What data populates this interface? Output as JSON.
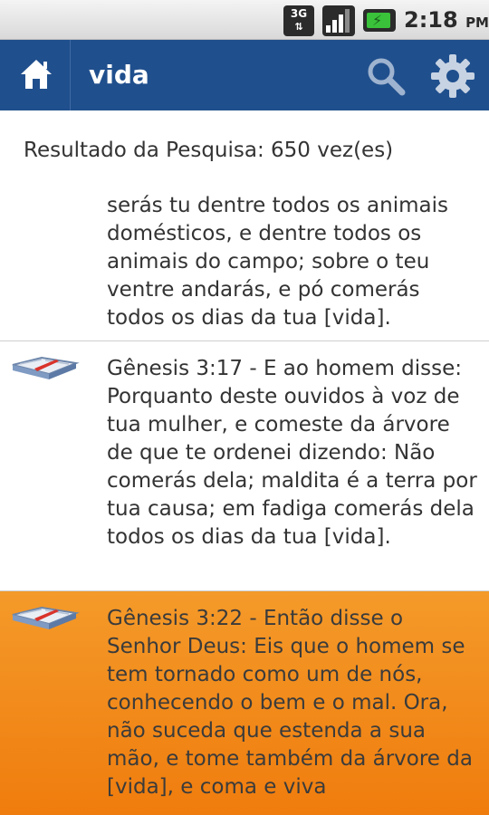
{
  "status_bar": {
    "network": "3G",
    "time": "2:18",
    "ampm": "PM"
  },
  "action_bar": {
    "title": "vida",
    "icons": [
      "home-icon",
      "search-icon",
      "gear-icon"
    ]
  },
  "results": {
    "summary": "Resultado da Pesquisa: 650 vez(es)",
    "items": [
      {
        "text": "serás tu dentre todos os animais domésticos, e dentre todos os animais do campo; sobre o teu ventre andarás, e pó comerás todos os dias da tua [vida].",
        "icon": "",
        "selected": false
      },
      {
        "text": "Gênesis 3:17 - E ao homem disse: Porquanto deste ouvidos à voz de tua mulher, e comeste da árvore de que te ordenei dizendo: Não comerás dela; maldita é a terra por tua causa; em fadiga comerás dela todos os dias da tua [vida].",
        "icon": "open-book-icon",
        "selected": false
      },
      {
        "text": "Gênesis 3:22 - Então disse o Senhor Deus: Eis que o homem se tem tornado como um de nós, conhecendo o bem e o mal. Ora, não suceda que estenda a sua mão, e tome também da árvore da [vida], e coma e viva",
        "icon": "open-book-icon",
        "selected": true
      }
    ]
  },
  "colors": {
    "action_bar": "#204f8d",
    "selected_row": "#f18a1c",
    "text": "#333333"
  }
}
